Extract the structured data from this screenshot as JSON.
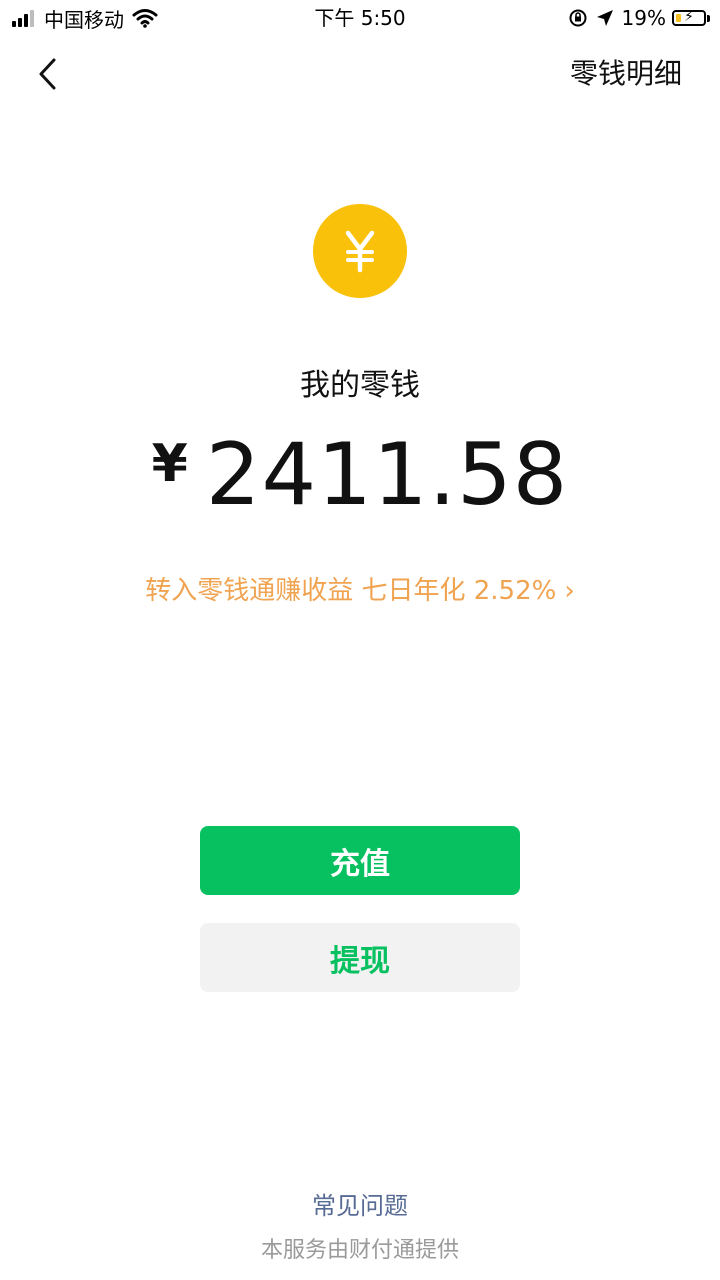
{
  "status_bar": {
    "carrier": "中国移动",
    "time": "下午 5:50",
    "battery_percent": "19%",
    "battery_level": 0.19
  },
  "nav": {
    "back_icon": "chevron-left-icon",
    "title": "零钱明细"
  },
  "balance": {
    "coin_icon": "yuan-coin-icon",
    "coin_symbol": "¥",
    "label": "我的零钱",
    "currency": "¥",
    "amount": "2411.58"
  },
  "promo": {
    "text": "转入零钱通赚收益 七日年化 2.52%",
    "chevron": "›",
    "color": "#f0a350"
  },
  "actions": {
    "recharge_label": "充值",
    "withdraw_label": "提现",
    "accent_color": "#07c160"
  },
  "footer": {
    "faq": "常见问题",
    "provider": "本服务由财付通提供"
  }
}
